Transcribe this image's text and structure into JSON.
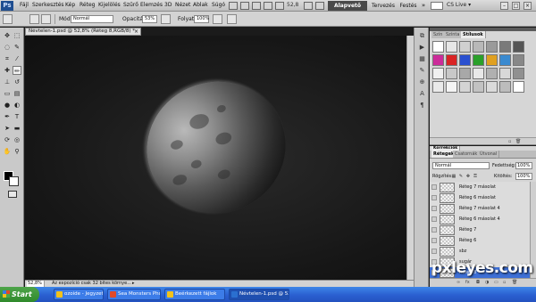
{
  "menubar": {
    "items": [
      "Fájl",
      "Szerkesztés",
      "Kép",
      "Réteg",
      "Kijelölés",
      "Szűrő",
      "Elemzés",
      "3D",
      "Nézet",
      "Ablak",
      "Súgó"
    ],
    "zoom": "52,8",
    "workspaces": [
      "Alapvető",
      "Tervezés",
      "Festés",
      "»"
    ],
    "cs_live": "CS Live ▾",
    "window_controls": [
      "–",
      "□",
      "×"
    ]
  },
  "options": {
    "mode_label": "Mód:",
    "mode_value": "Normál",
    "opacity_label": "Opacitás:",
    "opacity_value": "53%",
    "flow_label": "Folyat:",
    "flow_value": "100%"
  },
  "document": {
    "tab_title": "Névtelen-1.psd @ 52,8% (Réteg 8,RGB/8) *",
    "close_glyph": "×"
  },
  "status": {
    "zoom": "52,8%",
    "info": "Az expozíció csak 32 bites környe...",
    "arrow": "▸"
  },
  "styles_panel": {
    "tabs": [
      "Szín",
      "Színta",
      "Stílusok"
    ],
    "swatches": [
      "#ffffff",
      "#e6e6e6",
      "#d0d0d0",
      "#b8b8b8",
      "#9a9a9a",
      "#7a7a7a",
      "#555555",
      "#cc2b9a",
      "#d92424",
      "#2a50d0",
      "#2aa02a",
      "#e0a020",
      "#3a8ad0",
      "#888888",
      "#f0f0f0",
      "#c8c8c8",
      "#a8a8a8",
      "#e8e8e8",
      "#b0b0b0",
      "#d8d8d8",
      "#909090",
      "#eaeaea",
      "#f4f4f4",
      "#d4d4d4",
      "#c2c2c2",
      "#dadada",
      "#bcbcbc",
      "#ffffff"
    ]
  },
  "layers_panel": {
    "tabs": [
      "Rétegek",
      "Csatornák",
      "Útvonal"
    ],
    "header_tab": "Korrekciók",
    "blend_mode": "Normál",
    "opacity_label": "Fedettség:",
    "opacity_value": "100%",
    "lock_label": "Rögzítés:",
    "fill_label": "Kitöltés:",
    "fill_value": "100%",
    "layers": [
      {
        "name": "Réteg 7 másolat",
        "selected": false
      },
      {
        "name": "Réteg 6 másolat",
        "selected": false
      },
      {
        "name": "Réteg 7 másolat 4",
        "selected": false
      },
      {
        "name": "Réteg 6 másolat 4",
        "selected": false
      },
      {
        "name": "Réteg 7",
        "selected": false
      },
      {
        "name": "Réteg 6",
        "selected": false
      },
      {
        "name": "sbz",
        "selected": false
      },
      {
        "name": "sugár",
        "selected": false
      },
      {
        "name": "Réteg 8",
        "selected": true
      }
    ]
  },
  "taskbar": {
    "start": "Start",
    "tasks": [
      {
        "label": "ozoide - Jegyzettömb",
        "color": "#f2c21a",
        "active": false
      },
      {
        "label": "Sea Monsters Photos...",
        "color": "#e04a2a",
        "active": false
      },
      {
        "label": "Beérkezett fájlok",
        "color": "#f2c21a",
        "active": false
      },
      {
        "label": "Névtelen-1.psd @ 52...",
        "color": "#2a6fd0",
        "active": true
      }
    ]
  },
  "watermark": "pxleyes.com"
}
